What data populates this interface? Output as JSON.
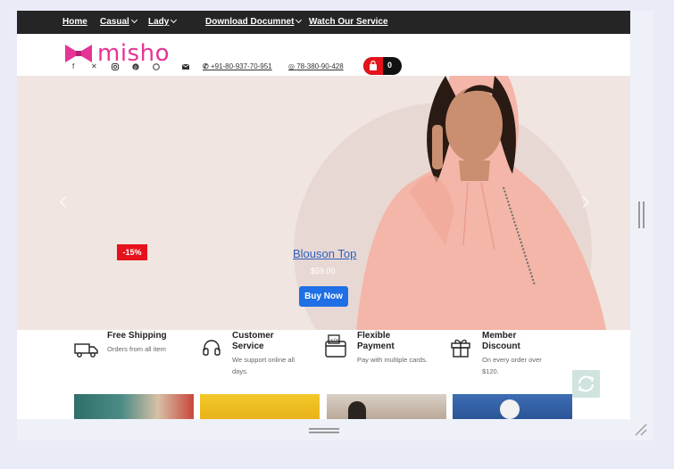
{
  "nav": {
    "items": [
      {
        "label": "Home",
        "dropdown": false
      },
      {
        "label": "Casual",
        "dropdown": true
      },
      {
        "label": "Lady",
        "dropdown": true
      },
      {
        "label": "Download Documnet",
        "dropdown": true
      },
      {
        "label": "Watch Our Service",
        "dropdown": false
      }
    ]
  },
  "brand": {
    "name": "misho",
    "color": "#e53495"
  },
  "header": {
    "social": [
      "facebook-icon",
      "x-icon",
      "instagram-icon",
      "pinterest-icon",
      "whatsapp-icon"
    ],
    "phone": "+91-80-937-70-951",
    "whatsapp": "78-380-90-428",
    "cart_count": "0"
  },
  "hero": {
    "discount": "-15%",
    "product_title": "Blouson Top",
    "price": "$59.00",
    "button": "Buy Now"
  },
  "features": [
    {
      "icon": "truck-icon",
      "title": "Free Shipping",
      "desc": "Orders from all item"
    },
    {
      "icon": "headphones-icon",
      "title": "Customer Service",
      "desc": "We support online all days."
    },
    {
      "icon": "wallet-icon",
      "title": "Flexible Payment",
      "desc": "Pay with multiple cards."
    },
    {
      "icon": "gift-icon",
      "title": "Member Discount",
      "desc": "On every order over $120."
    }
  ],
  "colors": {
    "nav_bg": "#252525",
    "accent_red": "#e6131b",
    "button_blue": "#1f6fe5"
  }
}
